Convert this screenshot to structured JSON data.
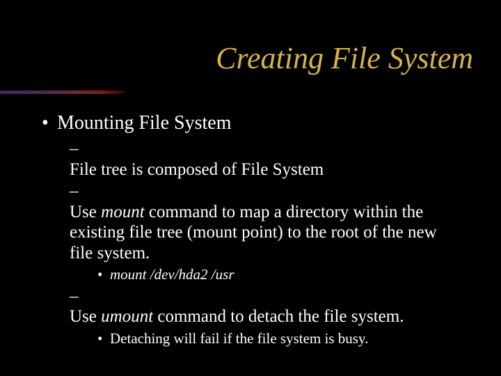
{
  "title": "Creating File System",
  "lvl1": "Mounting File System",
  "sub1": "File tree is composed of File System",
  "sub2_a": "Use ",
  "sub2_b": "mount",
  "sub2_c": " command to map a directory within the existing file tree (mount point) to the root of the new file system.",
  "sub2_cmd": "mount /dev/hda2 /usr",
  "sub3_a": "Use ",
  "sub3_b": "umount",
  "sub3_c": " command to detach the file system.",
  "sub3_note": "Detaching will fail if the file system is busy."
}
